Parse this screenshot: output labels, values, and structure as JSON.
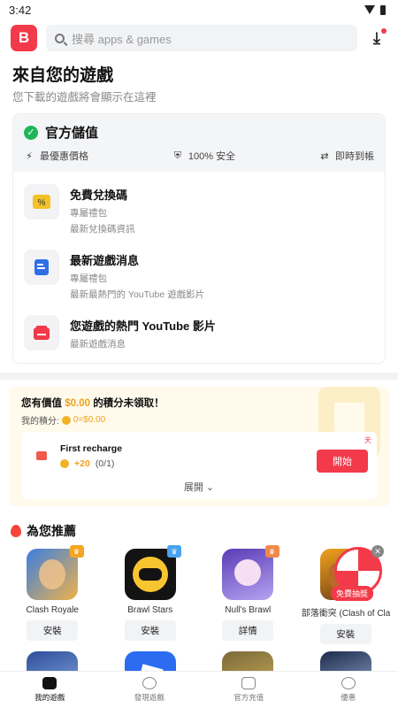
{
  "status_bar": {
    "time": "3:42"
  },
  "header": {
    "logo_letter": "B",
    "search_placeholder": "搜尋 apps & games"
  },
  "section": {
    "title": "來自您的遊戲",
    "subtitle": "您下載的遊戲將會顯示在這裡"
  },
  "official": {
    "title": "官方儲值",
    "features": [
      "最優惠價格",
      "100% 安全",
      "即時到帳"
    ],
    "items": [
      {
        "title": "免費兌換碼",
        "sub1": "專屬禮包",
        "sub2": "最新兌換碼資訊"
      },
      {
        "title": "最新遊戲消息",
        "sub1": "專屬禮包",
        "sub2": "最新最熱門的 YouTube 遊戲影片"
      },
      {
        "title": "您遊戲的熱門 YouTube 影片",
        "sub1": "最新遊戲消息",
        "sub2": ""
      }
    ]
  },
  "rewards": {
    "title_pre": "您有價值",
    "amount": "$0.00",
    "title_post": "的積分未領取！",
    "points_label": "我的積分:",
    "points_value": "0=$0.00",
    "task_name": "First recharge",
    "task_reward": "+20",
    "task_progress": "(0/1)",
    "day_tag": "天",
    "start_label": "開始",
    "expand_label": "展開"
  },
  "recommend": {
    "title": "為您推薦",
    "apps": [
      {
        "name": "Clash Royale",
        "action": "安裝"
      },
      {
        "name": "Brawl Stars",
        "action": "安裝"
      },
      {
        "name": "Null's Brawl",
        "action": "詳情"
      },
      {
        "name": "部落衝突 (Clash of Clans)",
        "action": "安裝"
      }
    ]
  },
  "floater": {
    "label": "免費抽獎"
  },
  "bottom_nav": [
    "我的遊戲",
    "發現遊戲",
    "官方充值",
    "優惠"
  ],
  "colors": {
    "accent": "#f23a4a",
    "gold": "#f0a21a",
    "green": "#1fb55a"
  }
}
